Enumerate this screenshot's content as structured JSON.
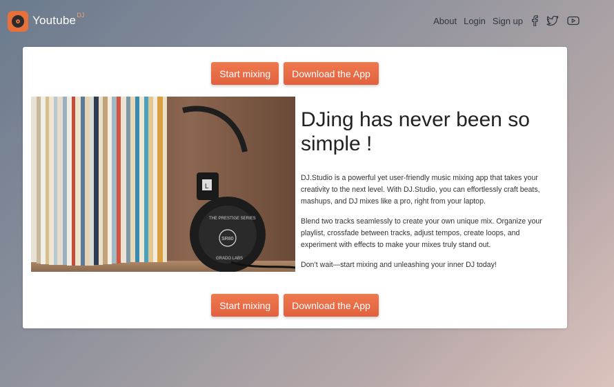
{
  "header": {
    "brand": "Youtube",
    "brand_sup": "DJ",
    "nav": [
      {
        "label": "About"
      },
      {
        "label": "Login"
      },
      {
        "label": "Sign up"
      }
    ],
    "social_icons": [
      "facebook-icon",
      "twitter-icon",
      "youtube-icon"
    ]
  },
  "hero_card": {
    "buttons_top": {
      "primary": "Start mixing",
      "secondary": "Download the App"
    },
    "headline": "DJing has never been so simple !",
    "paragraphs": [
      "DJ.Studio is a powerful yet user-friendly music mixing app that takes your creativity to the next level. With DJ.Studio, you can effortlessly craft beats, mashups, and DJ mixes like a pro, right from your laptop.",
      "Blend two tracks seamlessly to create your own unique mix. Organize your playlist, crossfade between tracks, adjust tempos, create loops, and experiment with effects to make your mixes truly stand out.",
      "Don’t wait—start mixing and unleashing your inner DJ today!"
    ],
    "image_alt": "Vinyl records and headphones",
    "headphone_text": [
      "THE PRESTIGE SERIES",
      "SR80",
      "GRADO LABS",
      "L"
    ],
    "buttons_bottom": {
      "primary": "Start mixing",
      "secondary": "Download the App"
    }
  },
  "colors": {
    "accent": "#e8703a",
    "button_top": "#ee7a4e",
    "button_bottom": "#e2603f"
  }
}
